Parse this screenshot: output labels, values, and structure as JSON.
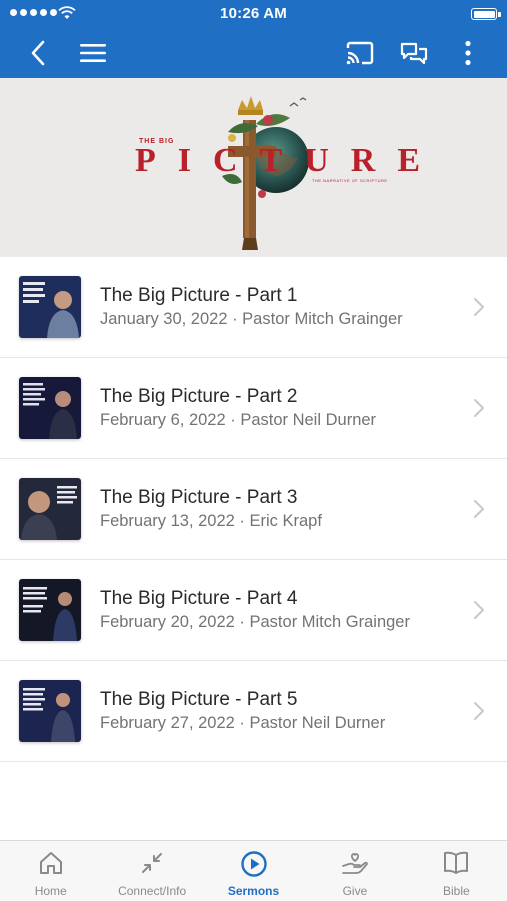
{
  "status_bar": {
    "time": "10:26 AM",
    "battery_level": 1.0
  },
  "header": {
    "back_icon": "chevron-left-icon",
    "menu_icon": "hamburger-menu-icon",
    "cast_icon": "cast-icon",
    "chat_icon": "chat-bubbles-icon",
    "more_icon": "more-vertical-icon",
    "color": "#1f6fc4"
  },
  "banner": {
    "word": "PICTURE",
    "small_text": "THE BIG",
    "tagline": "THE NARRATIVE OF SCRIPTURE",
    "accent": "#b8202a"
  },
  "sermons": [
    {
      "title": "The Big Picture - Part 1",
      "subtitle": "January 30, 2022 · Pastor Mitch Grainger"
    },
    {
      "title": "The Big Picture - Part 2",
      "subtitle": "February 6, 2022 · Pastor Neil Durner"
    },
    {
      "title": "The Big Picture - Part 3",
      "subtitle": "February 13, 2022 · Eric Krapf"
    },
    {
      "title": "The Big Picture - Part 4",
      "subtitle": "February 20, 2022 · Pastor Mitch Grainger"
    },
    {
      "title": "The Big Picture - Part 5",
      "subtitle": "February 27, 2022 · Pastor Neil Durner"
    }
  ],
  "tabs": [
    {
      "label": "Home",
      "icon": "home-icon",
      "active": false
    },
    {
      "label": "Connect/Info",
      "icon": "connect-arrows-icon",
      "active": false
    },
    {
      "label": "Sermons",
      "icon": "play-circle-icon",
      "active": true
    },
    {
      "label": "Give",
      "icon": "give-hand-heart-icon",
      "active": false
    },
    {
      "label": "Bible",
      "icon": "open-book-icon",
      "active": false
    }
  ]
}
